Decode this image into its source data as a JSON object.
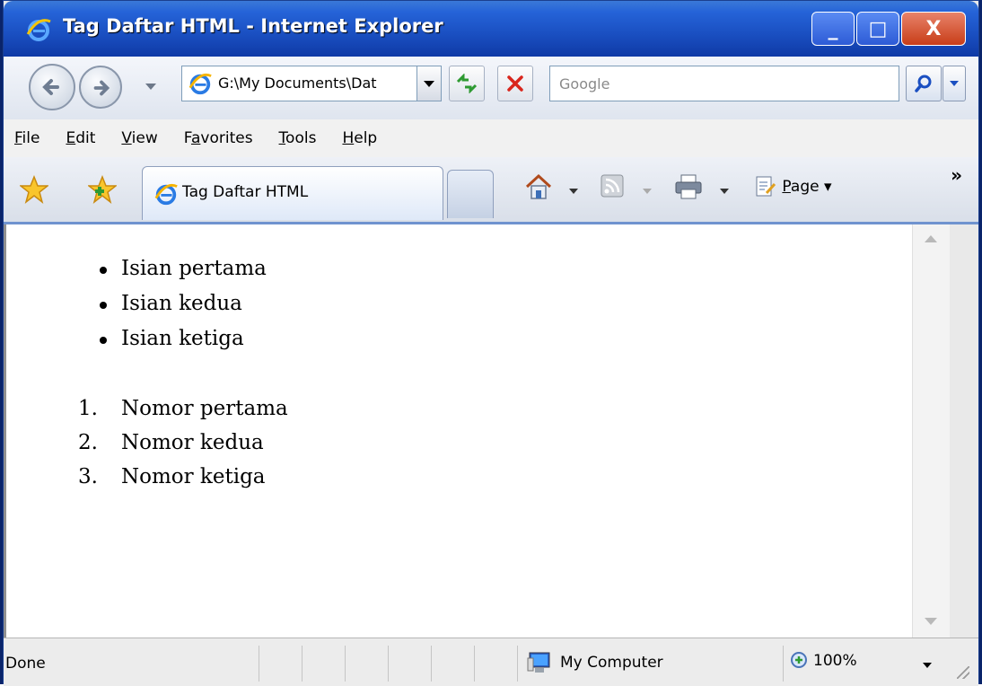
{
  "window": {
    "title": "Tag Daftar HTML - Internet Explorer",
    "minimize_label": "_",
    "maximize_label": "□",
    "close_label": "X"
  },
  "address_bar": {
    "url": "G:\\My Documents\\Dat",
    "search_placeholder": "Google"
  },
  "menu": {
    "items": [
      {
        "pre": "",
        "ul": "F",
        "post": "ile"
      },
      {
        "pre": "",
        "ul": "E",
        "post": "dit"
      },
      {
        "pre": "",
        "ul": "V",
        "post": "iew"
      },
      {
        "pre": "F",
        "ul": "a",
        "post": "vorites"
      },
      {
        "pre": "",
        "ul": "T",
        "post": "ools"
      },
      {
        "pre": "",
        "ul": "H",
        "post": "elp"
      }
    ]
  },
  "tabs": {
    "active_tab_label": "Tag Daftar HTML",
    "page_menu": {
      "ul": "P",
      "post": "age"
    },
    "overflow": "»"
  },
  "content": {
    "bullet_items": [
      "Isian pertama",
      "Isian kedua",
      "Isian ketiga"
    ],
    "numbered_items": [
      {
        "n": "1.",
        "text": "Nomor pertama"
      },
      {
        "n": "2.",
        "text": "Nomor kedua"
      },
      {
        "n": "3.",
        "text": "Nomor ketiga"
      }
    ]
  },
  "status": {
    "text": "Done",
    "zone": "My Computer",
    "zoom": "100%"
  },
  "icons": [
    "ie-logo-icon",
    "back-icon",
    "forward-icon",
    "refresh-icon",
    "stop-icon",
    "search-icon",
    "favorites-star-icon",
    "add-favorites-icon",
    "home-icon",
    "feeds-icon",
    "print-icon",
    "page-icon",
    "computer-icon",
    "zoom-icon"
  ],
  "colors": {
    "titlebar": "#1a4fc1",
    "close_button": "#c83d18",
    "tab_border": "#6f93cf"
  }
}
